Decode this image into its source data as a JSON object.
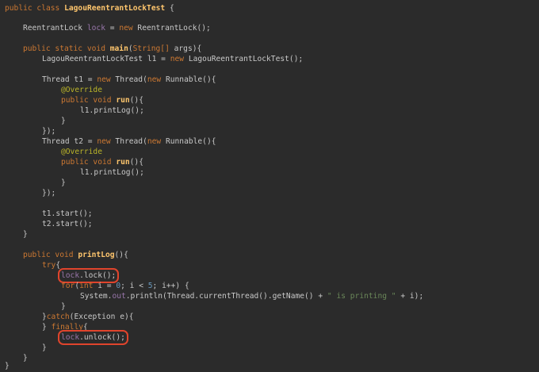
{
  "code": {
    "l1": {
      "kw": "public class ",
      "cls": "LagouReentrantLockTest",
      "rest": " {"
    },
    "l2": {
      "type": "ReentrantLock ",
      "fld": "lock",
      "eq": " = ",
      "kw": "new ",
      "rest": "ReentrantLock();"
    },
    "l3": {
      "kw1": "public static void ",
      "fn": "main",
      "p1": "(",
      "kw2": "String[]",
      "p2": " args){"
    },
    "l4": {
      "t": "LagouReentrantLockTest l1 = ",
      "kw": "new ",
      "rest": "LagouReentrantLockTest();"
    },
    "l5": {
      "t": "Thread t1 = ",
      "kw": "new ",
      "mid": "Thread(",
      "kw2": "new ",
      "rest": "Runnable(){"
    },
    "l6": {
      "ann": "@Override"
    },
    "l7": {
      "kw": "public void ",
      "fn": "run",
      "rest": "(){"
    },
    "l8": {
      "t": "l1.printLog();"
    },
    "l9": {
      "t": "}"
    },
    "l10": {
      "t": "});"
    },
    "l11": {
      "t": "Thread t2 = ",
      "kw": "new ",
      "mid": "Thread(",
      "kw2": "new ",
      "rest": "Runnable(){"
    },
    "l12": {
      "ann": "@Override"
    },
    "l13": {
      "kw": "public void ",
      "fn": "run",
      "rest": "(){"
    },
    "l14": {
      "t": "l1.printLog();"
    },
    "l15": {
      "t": "}"
    },
    "l16": {
      "t": "});"
    },
    "l17": {
      "t": "t1.start();"
    },
    "l18": {
      "t": "t2.start();"
    },
    "l19": {
      "t": "}"
    },
    "l20": {
      "kw": "public void ",
      "fn": "printLog",
      "rest": "(){"
    },
    "l21": {
      "kw": "try",
      "rest": "{"
    },
    "l22": {
      "fld": "lock",
      "rest": ".lock();"
    },
    "l23": {
      "kw": "for",
      "p1": "(",
      "kw2": "int ",
      "p2": "i = ",
      "num": "0",
      "p3": "; i < ",
      "num2": "5",
      "p4": "; i++) {"
    },
    "l24": {
      "t": "System.",
      "fld": "out",
      "mid": ".println(Thread.currentThread().getName() + ",
      "str": "\" is printing \"",
      "rest": " + i);"
    },
    "l25": {
      "t": "}"
    },
    "l26": {
      "p1": "}",
      "kw": "catch",
      "rest": "(Exception e){"
    },
    "l27": {
      "p1": "} ",
      "kw": "finally",
      "rest": "{"
    },
    "l28": {
      "fld": "lock",
      "rest": ".unlock();"
    },
    "l29": {
      "t": "}"
    },
    "l30": {
      "t": "}"
    },
    "l31": {
      "t": "}"
    }
  }
}
